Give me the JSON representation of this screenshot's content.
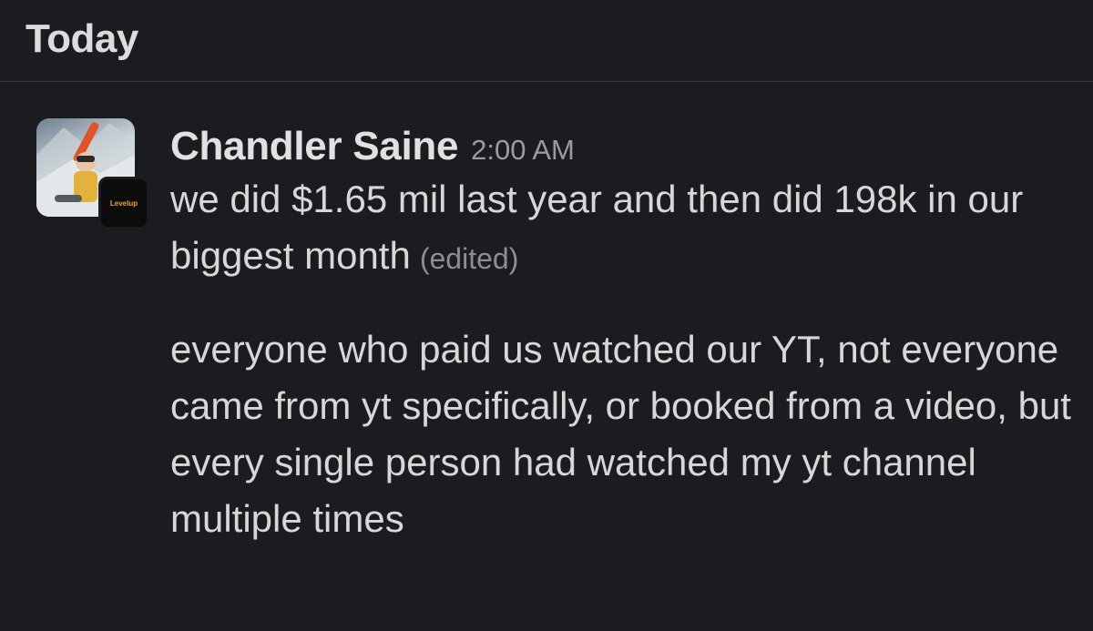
{
  "day_header": "Today",
  "message": {
    "author": "Chandler Saine",
    "timestamp": "2:00 AM",
    "paragraph_1": "we did $1.65 mil last year and then did 198k in our biggest month",
    "edited_label": "(edited)",
    "paragraph_2": "everyone who paid us watched our YT, not everyone came from yt specifically, or booked from a video, but every single person had watched my yt channel multiple times",
    "badge_text": "Levelup"
  },
  "colors": {
    "background": "#1b1c20",
    "text": "#d6d7d8",
    "muted": "#9b9c9e",
    "badge_accent": "#e8a23a"
  }
}
